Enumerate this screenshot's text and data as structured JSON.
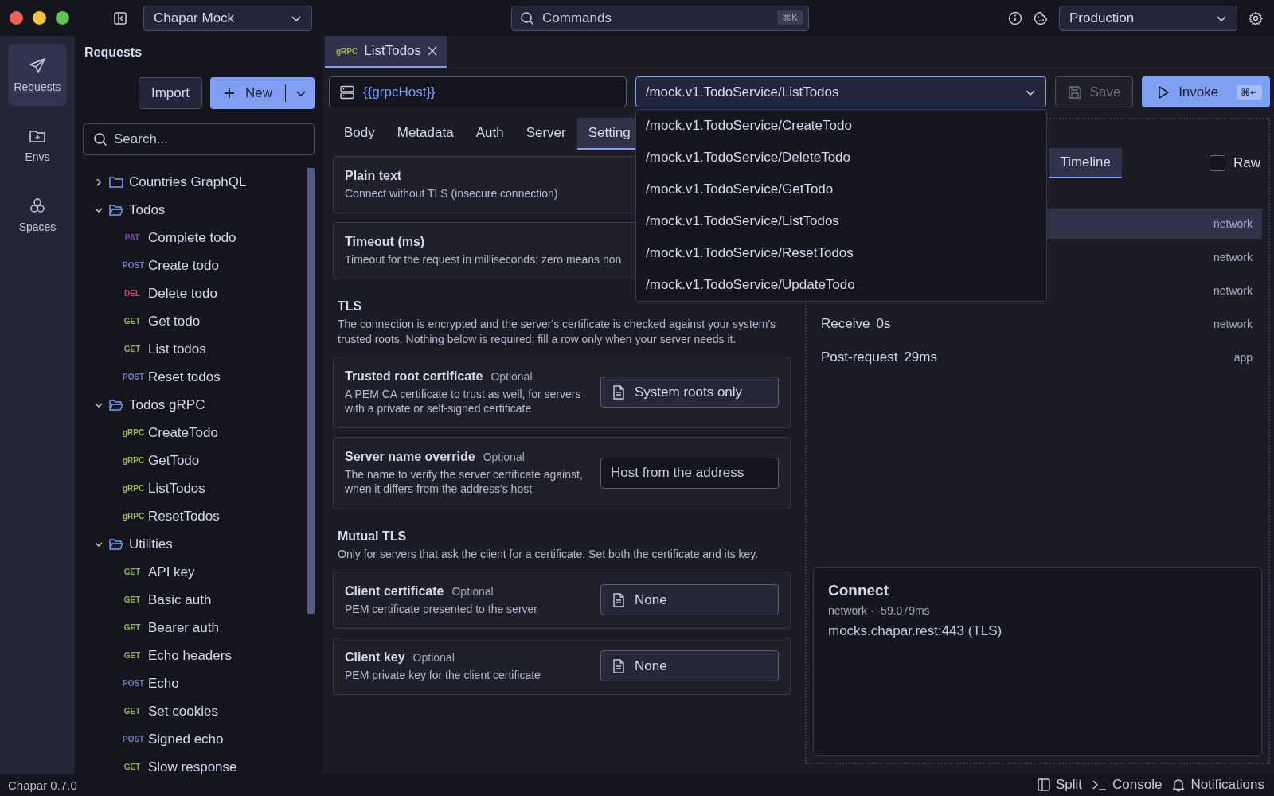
{
  "title_bar": {
    "workspace": "Chapar Mock",
    "command_search": {
      "placeholder": "Commands",
      "shortcut": "⌘K"
    },
    "environment": "Production"
  },
  "nav_rail": [
    {
      "kind": "requests",
      "label": "Requests",
      "selected": true
    },
    {
      "kind": "envs",
      "label": "Envs",
      "selected": false
    },
    {
      "kind": "spaces",
      "label": "Spaces",
      "selected": false
    }
  ],
  "sidebar": {
    "title": "Requests",
    "import_button": "Import",
    "new_button": "New",
    "search": {
      "placeholder": "Search..."
    },
    "tree": [
      {
        "kind": "folder",
        "name": "Countries GraphQL",
        "expanded": false
      },
      {
        "kind": "folder",
        "name": "Todos",
        "expanded": true,
        "children": [
          {
            "kind": "request",
            "method": "PAT",
            "color": "#8a3fa6",
            "name": "Complete todo"
          },
          {
            "kind": "request",
            "method": "POST",
            "color": "#6e80c4",
            "name": "Create todo"
          },
          {
            "kind": "request",
            "method": "DEL",
            "color": "#c4505c",
            "name": "Delete todo"
          },
          {
            "kind": "request",
            "method": "GET",
            "color": "#8faf5f",
            "name": "Get todo"
          },
          {
            "kind": "request",
            "method": "GET",
            "color": "#8faf5f",
            "name": "List todos"
          },
          {
            "kind": "request",
            "method": "POST",
            "color": "#6e80c4",
            "name": "Reset todos"
          }
        ]
      },
      {
        "kind": "folder",
        "name": "Todos gRPC",
        "expanded": true,
        "children": [
          {
            "kind": "request",
            "method": "gRPC",
            "color": "#9fb65a",
            "name": "CreateTodo"
          },
          {
            "kind": "request",
            "method": "gRPC",
            "color": "#9fb65a",
            "name": "GetTodo"
          },
          {
            "kind": "request",
            "method": "gRPC",
            "color": "#9fb65a",
            "name": "ListTodos"
          },
          {
            "kind": "request",
            "method": "gRPC",
            "color": "#9fb65a",
            "name": "ResetTodos"
          }
        ]
      },
      {
        "kind": "folder",
        "name": "Utilities",
        "expanded": true,
        "children": [
          {
            "kind": "request",
            "method": "GET",
            "color": "#8faf5f",
            "name": "API key"
          },
          {
            "kind": "request",
            "method": "GET",
            "color": "#8faf5f",
            "name": "Basic auth"
          },
          {
            "kind": "request",
            "method": "GET",
            "color": "#8faf5f",
            "name": "Bearer auth"
          },
          {
            "kind": "request",
            "method": "GET",
            "color": "#8faf5f",
            "name": "Echo headers"
          },
          {
            "kind": "request",
            "method": "POST",
            "color": "#6e80c4",
            "name": "Echo"
          },
          {
            "kind": "request",
            "method": "GET",
            "color": "#8faf5f",
            "name": "Set cookies"
          },
          {
            "kind": "request",
            "method": "POST",
            "color": "#6e80c4",
            "name": "Signed echo"
          },
          {
            "kind": "request",
            "method": "GET",
            "color": "#8faf5f",
            "name": "Slow response"
          }
        ]
      }
    ]
  },
  "request_tabs": [
    {
      "method": "gRPC",
      "color": "#9fb65a",
      "name": "ListTodos",
      "selected": true
    }
  ],
  "address": {
    "host": "{{grpcHost}}",
    "method_select": "/mock.v1.TodoService/ListTodos",
    "save_button": "Save",
    "save_disabled": true,
    "invoke_button": "Invoke",
    "invoke_shortcut": "⌘↵"
  },
  "method_dropdown": {
    "open": true,
    "options": [
      {
        "label": "/mock.v1.TodoService/CreateTodo"
      },
      {
        "label": "/mock.v1.TodoService/DeleteTodo"
      },
      {
        "label": "/mock.v1.TodoService/GetTodo"
      },
      {
        "label": "/mock.v1.TodoService/ListTodos"
      },
      {
        "label": "/mock.v1.TodoService/ResetTodos"
      },
      {
        "label": "/mock.v1.TodoService/UpdateTodo"
      }
    ]
  },
  "sub_tabs": [
    {
      "label": "Body",
      "selected": false
    },
    {
      "label": "Metadata",
      "selected": false
    },
    {
      "label": "Auth",
      "selected": false
    },
    {
      "label": "Server",
      "selected": false
    },
    {
      "label": "Setting",
      "selected": true
    }
  ],
  "settings": [
    {
      "kind": "card",
      "title": "Plain text",
      "description": "Connect without TLS (insecure connection)"
    },
    {
      "kind": "card",
      "title": "Timeout (ms)",
      "description": "Timeout for the request in milliseconds; zero means non"
    },
    {
      "kind": "heading",
      "title": "TLS",
      "description": "The connection is encrypted and the server's certificate is checked against your system's trusted roots. Nothing below is required; fill a row only when your server needs it."
    },
    {
      "kind": "card",
      "title": "Trusted root certificate",
      "optional": "Optional",
      "description": "A PEM CA certificate to trust as well, for servers with a private or self-signed certificate",
      "control": {
        "kind": "file",
        "value": "System roots only"
      }
    },
    {
      "kind": "card",
      "title": "Server name override",
      "optional": "Optional",
      "description": "The name to verify the server certificate against, when it differs from the address's host",
      "control": {
        "kind": "input",
        "placeholder": "Host from the address"
      }
    },
    {
      "kind": "heading",
      "title": "Mutual TLS",
      "description": "Only for servers that ask the client for a certificate. Set both the certificate and its key."
    },
    {
      "kind": "card",
      "title": "Client certificate",
      "optional": "Optional",
      "description": "PEM certificate presented to the server",
      "control": {
        "kind": "file",
        "value": "None"
      }
    },
    {
      "kind": "card",
      "title": "Client key",
      "optional": "Optional",
      "description": "PEM private key for the client certificate",
      "control": {
        "kind": "file",
        "value": "None"
      }
    }
  ],
  "response": {
    "tabs": [
      {
        "label": "Timeline",
        "selected": true
      }
    ],
    "raw": {
      "label": "Raw",
      "checked": false
    },
    "timeline": [
      {
        "source": "network",
        "selected": true
      },
      {
        "source": "network",
        "selected": false
      },
      {
        "source": "network",
        "selected": false
      },
      {
        "step": "Receive",
        "duration": "0s",
        "source": "network",
        "selected": false
      },
      {
        "step": "Post-request",
        "duration": "29ms",
        "source": "app",
        "selected": false
      }
    ],
    "detail": {
      "title": "Connect",
      "meta": "network · -59.079ms",
      "body": "mocks.chapar.rest:443 (TLS)"
    }
  },
  "status_bar": {
    "version": "Chapar 0.7.0",
    "buttons": [
      {
        "kind": "split",
        "label": "Split"
      },
      {
        "kind": "console",
        "label": "Console"
      },
      {
        "kind": "notifications",
        "label": "Notifications"
      }
    ]
  }
}
